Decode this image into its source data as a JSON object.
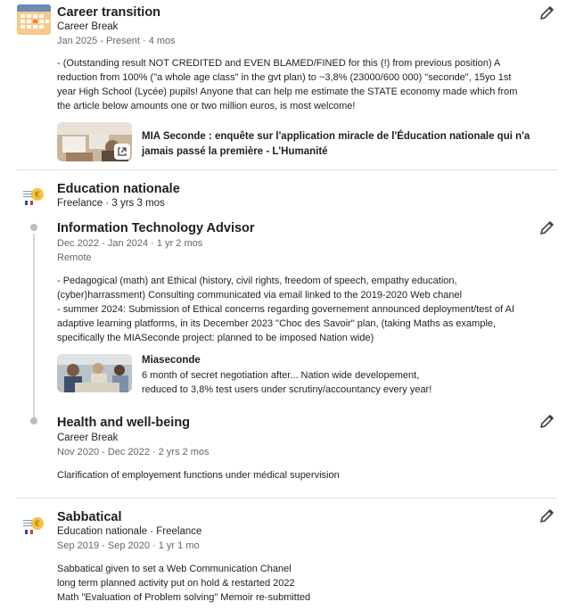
{
  "entries": [
    {
      "title": "Career transition",
      "subtitle": "Career Break",
      "dates": "Jan 2025 - Present · 4 mos",
      "description": [
        "- (Outstanding result NOT CREDITED and EVEN BLAMED/FINED for this (!) from previous position) A",
        "reduction from 100% (\"a whole age class\" in the gvt plan) to ~3,8% (23000/600 000) \"seconde\", 15yo 1st",
        "year High School (Lycée) pupils! Anyone that can help me estimate the STATE economy made which from",
        "the article below amounts one or two million euros, is most welcome!"
      ],
      "media": {
        "title_lines": [
          "MIA Seconde : enquête sur l'application miracle de l'Éducation nationale qui n'a",
          "jamais passé la première - L'Humanité"
        ]
      }
    },
    {
      "org": "Education nationale",
      "org_meta": "Freelance · 3 yrs 3 mos",
      "roles": [
        {
          "title": "Information Technology Advisor",
          "dates": "Dec 2022 - Jan 2024 · 1 yr 2 mos",
          "location": "Remote",
          "description": [
            "- Pedagogical (math) ant Ethical (history, civil rights, freedom of speech, empathy education,",
            "(cyber)harrassment) Consulting communicated via email linked to the 2019-2020 Web chanel",
            "- summer 2024: Submission of Ethical concerns regarding governement announced deployment/test of AI",
            "adaptive learning platforms, in its December 2023 \"Choc des Savoir\" plan, (taking Maths as example,",
            "specifically the MIASeconde project: planned to be imposed Nation wide)"
          ],
          "media": {
            "title": "Miaseconde",
            "lines": [
              "6 month of secret negotiation after... Nation wide developement,",
              "reduced to 3,8% test users under scrutiny/accountancy every year!"
            ]
          }
        },
        {
          "title": "Health and well-being",
          "subtitle": "Career Break",
          "dates": "Nov 2020 - Dec 2022 · 2 yrs 2 mos",
          "description": [
            "Clarification of employement functions under médical supervision"
          ]
        }
      ]
    },
    {
      "title": "Sabbatical",
      "subtitle": "Education nationale · Freelance",
      "dates": "Sep 2019 - Sep 2020 · 1 yr 1 mo",
      "description": [
        "Sabbatical given to set a Web Communication Chanel",
        "long term planned activity put on hold & restarted 2022",
        "Math \"Evaluation of Problem solving\" Memoir re-submitted"
      ]
    }
  ],
  "colors": {
    "calendar_orange": "#f5a623",
    "calendar_blue": "#6b8bb5",
    "rail": "#d6d6d6"
  }
}
